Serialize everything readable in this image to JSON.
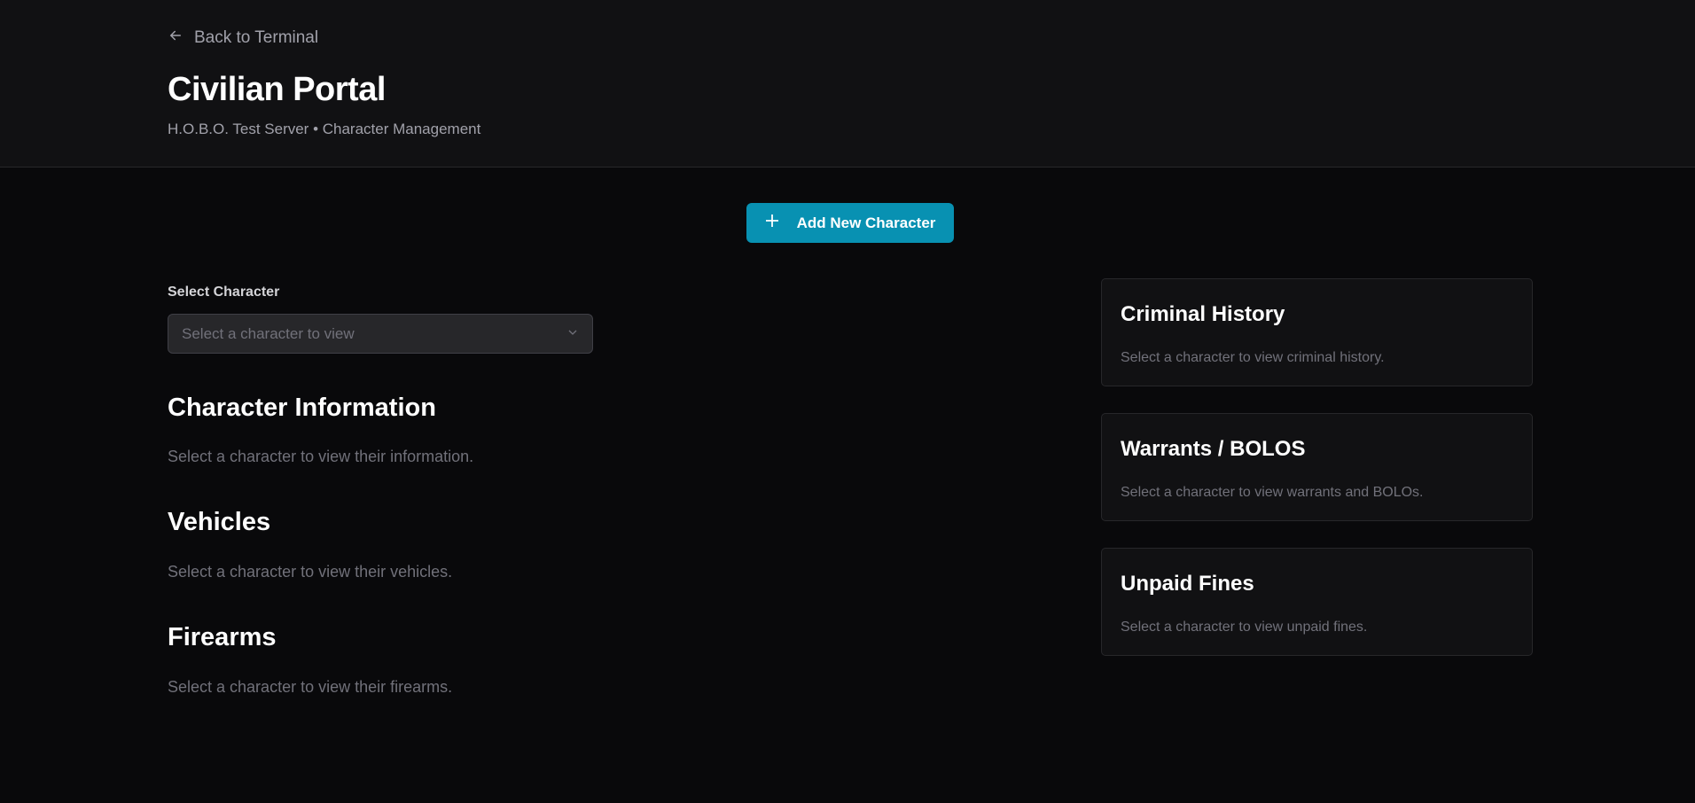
{
  "header": {
    "back_label": "Back to Terminal",
    "title": "Civilian Portal",
    "subtitle": "H.O.B.O. Test Server • Character Management"
  },
  "actions": {
    "add_character_label": "Add New Character"
  },
  "selector": {
    "label": "Select Character",
    "placeholder": "Select a character to view"
  },
  "sections": [
    {
      "title": "Character Information",
      "empty": "Select a character to view their information."
    },
    {
      "title": "Vehicles",
      "empty": "Select a character to view their vehicles."
    },
    {
      "title": "Firearms",
      "empty": "Select a character to view their firearms."
    }
  ],
  "cards": [
    {
      "title": "Criminal History",
      "empty": "Select a character to view criminal history."
    },
    {
      "title": "Warrants / BOLOS",
      "empty": "Select a character to view warrants and BOLOs."
    },
    {
      "title": "Unpaid Fines",
      "empty": "Select a character to view unpaid fines."
    }
  ],
  "colors": {
    "accent": "#0891b2",
    "background": "#09090b",
    "header": "#111113"
  }
}
